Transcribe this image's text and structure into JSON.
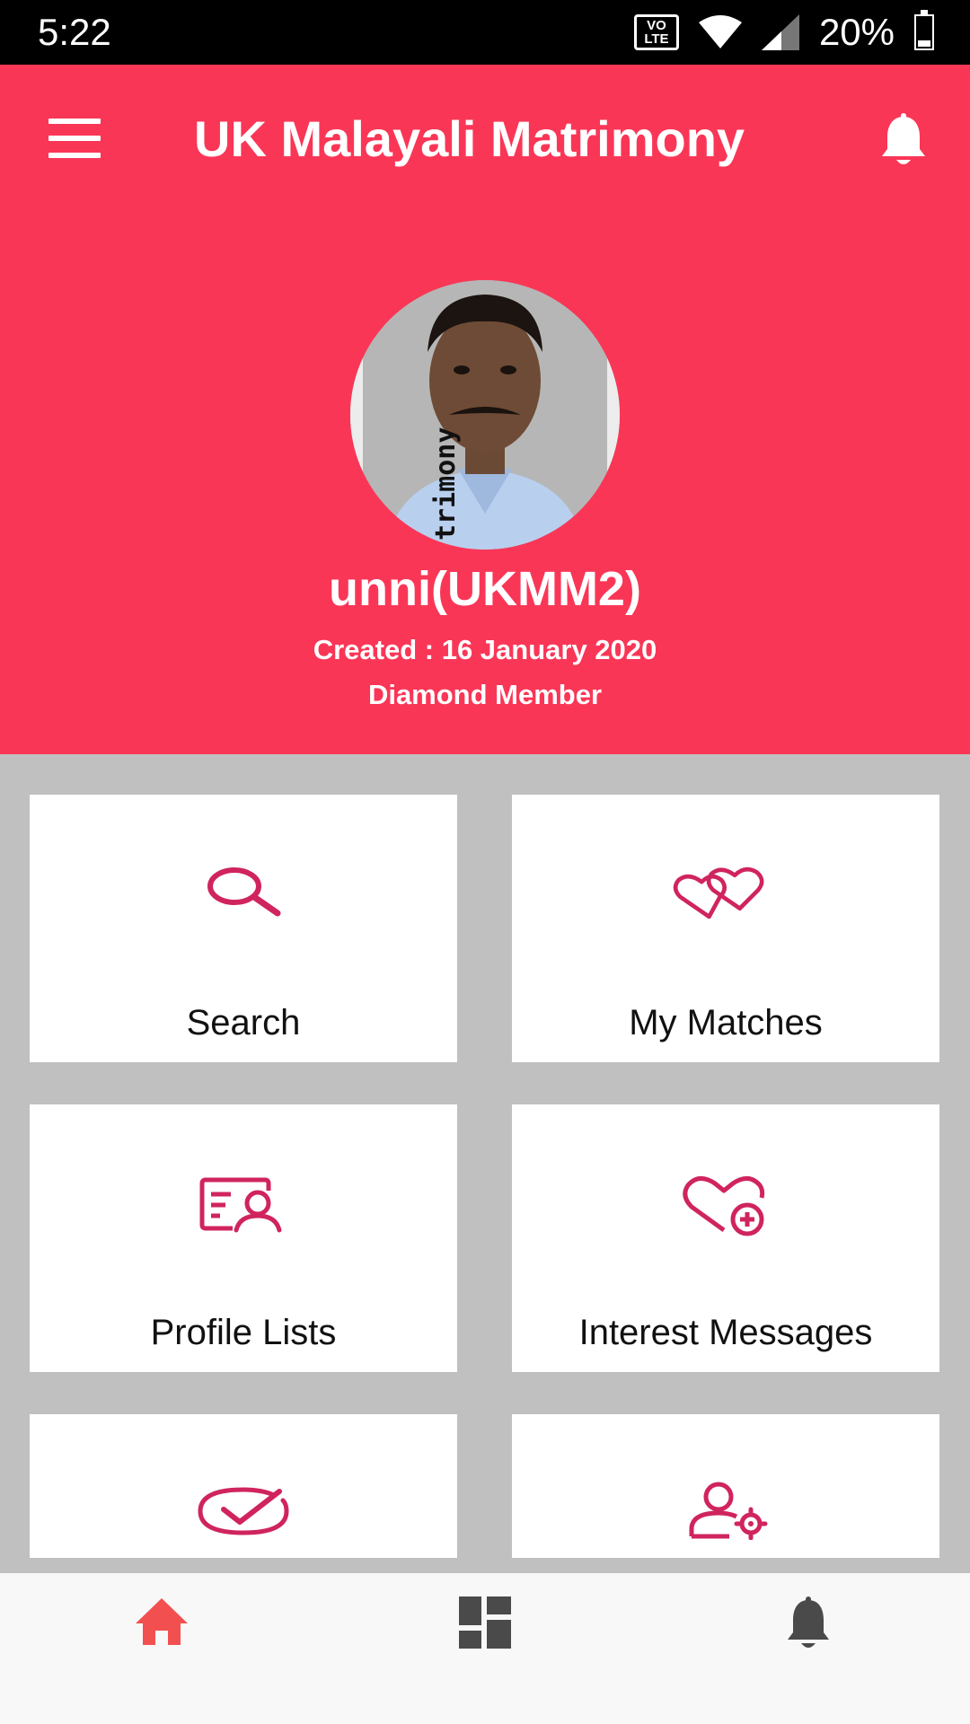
{
  "status_bar": {
    "time": "5:22",
    "network_badge": "VO LTE",
    "battery_percent": "20%",
    "battery_level": 0.2
  },
  "app_bar": {
    "title": "UK Malayali Matrimony",
    "menu_icon": "hamburger-menu-icon",
    "notification_icon": "bell-icon"
  },
  "profile": {
    "name": "unni(UKMM2)",
    "created": "Created :  16 January 2020",
    "membership": "Diamond Member",
    "photo_watermark": "trimony"
  },
  "tiles": [
    {
      "label": "Search",
      "icon": "search-icon"
    },
    {
      "label": "My Matches",
      "icon": "linked-hearts-icon"
    },
    {
      "label": "Profile Lists",
      "icon": "profile-card-icon"
    },
    {
      "label": "Interest Messages",
      "icon": "heart-plus-icon"
    },
    {
      "label": "",
      "icon": "check-circle-icon"
    },
    {
      "label": "",
      "icon": "user-settings-icon"
    }
  ],
  "bottom_nav": [
    {
      "icon": "home-icon",
      "active": true
    },
    {
      "icon": "dashboard-icon",
      "active": false
    },
    {
      "icon": "bell-icon",
      "active": false
    }
  ],
  "colors": {
    "primary": "#fa3657",
    "icon_accent": "#d0245e",
    "active_nav": "#f25050",
    "inactive_nav": "#4a4a4a",
    "grid_background": "#c0c0c0"
  }
}
